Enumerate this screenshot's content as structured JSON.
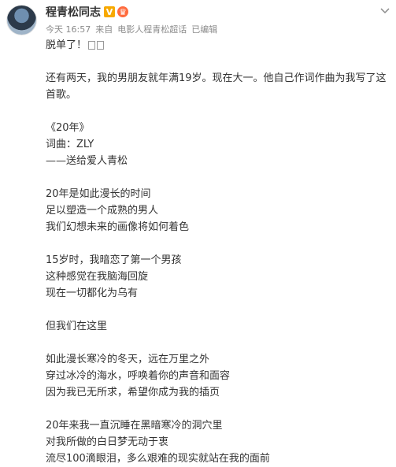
{
  "author": {
    "name": "程青松同志",
    "verified_icon": "verified-v-icon",
    "member_icon": "member-crown-icon"
  },
  "meta": {
    "time": "今天 16:57",
    "source_prefix": "来自",
    "source": "电影人程青松超话",
    "edited": "已编辑"
  },
  "content": {
    "first_line": "脱单了！",
    "intro": "还有两天，我的男朋友就年满19岁。现在大一。他自己作词作曲为我写了这首歌。",
    "song_title": "《20年》",
    "credit": "词曲：ZLY",
    "dedication": "——送给爱人青松",
    "verse1": [
      "20年是如此漫长的时间",
      "足以塑造一个成熟的男人",
      "我们幻想未来的画像将如何着色"
    ],
    "verse2": [
      "15岁时，我暗恋了第一个男孩",
      "这种感觉在我脑海回旋",
      "现在一切都化为乌有"
    ],
    "bridge": "但我们在这里",
    "verse3": [
      "如此漫长寒冷的冬天，远在万里之外",
      "穿过冰冷的海水，呼唤着你的声音和面容",
      "因为我已无所求，希望你成为我的插页"
    ],
    "verse4": [
      "20年来我一直沉睡在黑暗寒冷的洞穴里",
      "对我所做的白日梦无动于衷",
      "流尽100滴眼泪，多么艰难的现实就站在我的面前"
    ]
  }
}
